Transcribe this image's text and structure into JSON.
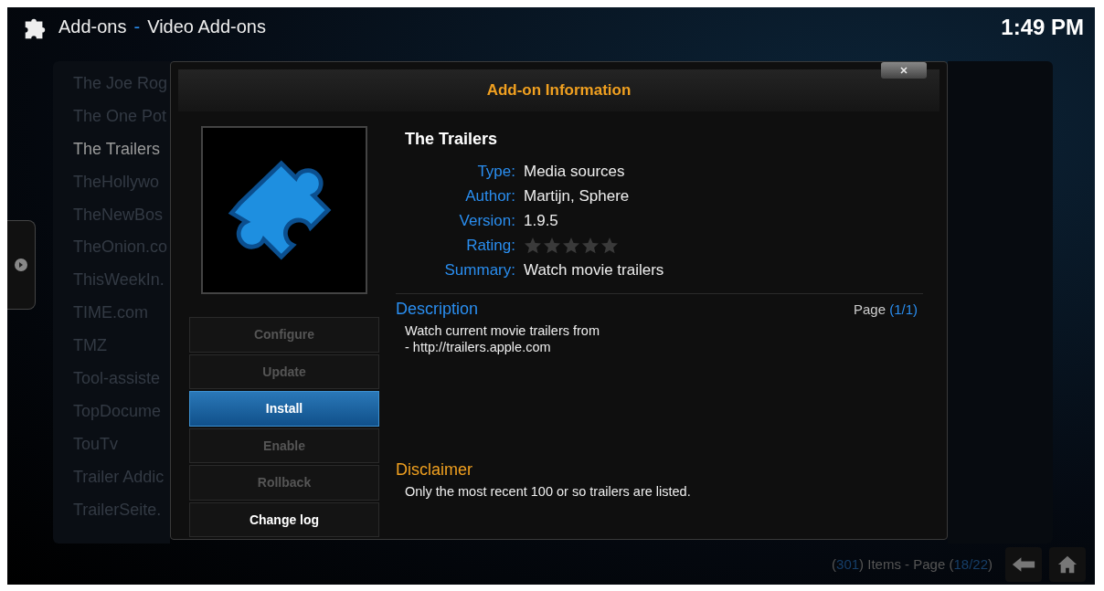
{
  "header": {
    "section": "Add-ons",
    "separator": "-",
    "page": "Video Add-ons",
    "time": "1:49 PM"
  },
  "list": {
    "items": [
      {
        "label": "The Joe Rog",
        "selected": false
      },
      {
        "label": "The One Pot",
        "selected": false
      },
      {
        "label": "The Trailers",
        "selected": true
      },
      {
        "label": "TheHollywo",
        "selected": false
      },
      {
        "label": "TheNewBos",
        "selected": false
      },
      {
        "label": "TheOnion.co",
        "selected": false
      },
      {
        "label": "ThisWeekIn.",
        "selected": false
      },
      {
        "label": "TIME.com",
        "selected": false
      },
      {
        "label": "TMZ",
        "selected": false
      },
      {
        "label": "Tool-assiste",
        "selected": false
      },
      {
        "label": "TopDocume",
        "selected": false
      },
      {
        "label": "TouTv",
        "selected": false
      },
      {
        "label": "Trailer Addic",
        "selected": false
      },
      {
        "label": "TrailerSeite.",
        "selected": false
      }
    ]
  },
  "dialog": {
    "title": "Add-on Information",
    "name": "The Trailers",
    "fields": [
      {
        "label": "Type:",
        "value": "Media sources",
        "kind": "text"
      },
      {
        "label": "Author:",
        "value": "Martijn, Sphere",
        "kind": "text"
      },
      {
        "label": "Version:",
        "value": "1.9.5",
        "kind": "text"
      },
      {
        "label": "Rating:",
        "stars": 0,
        "kind": "stars"
      },
      {
        "label": "Summary:",
        "value": "Watch movie trailers",
        "kind": "text"
      }
    ],
    "buttons": [
      {
        "label": "Configure",
        "disabled": true,
        "selected": false
      },
      {
        "label": "Update",
        "disabled": true,
        "selected": false
      },
      {
        "label": "Install",
        "disabled": false,
        "selected": true
      },
      {
        "label": "Enable",
        "disabled": true,
        "selected": false
      },
      {
        "label": "Rollback",
        "disabled": true,
        "selected": false
      },
      {
        "label": "Change log",
        "disabled": false,
        "selected": false
      }
    ],
    "description": {
      "heading": "Description",
      "page": [
        {
          "text": "Page ",
          "kind": "plain"
        },
        {
          "text": "(1/1)",
          "kind": "accent"
        }
      ],
      "lines": [
        "Watch current movie trailers from",
        "- http://trailers.apple.com"
      ]
    },
    "disclaimer": {
      "heading": "Disclaimer",
      "text": "Only the most recent 100 or so trailers are listed."
    }
  },
  "footer": {
    "parts": [
      {
        "text": "(",
        "kind": "plain"
      },
      {
        "text": "301",
        "kind": "accent"
      },
      {
        "text": ") Items - Page (",
        "kind": "plain"
      },
      {
        "text": "18/22",
        "kind": "accent"
      },
      {
        "text": ")",
        "kind": "plain"
      }
    ]
  }
}
